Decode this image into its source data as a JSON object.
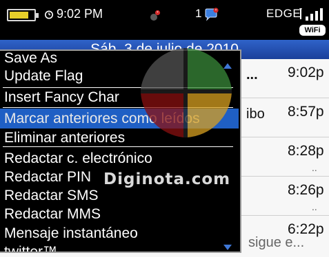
{
  "status_bar": {
    "battery_level": 0.7,
    "battery_color": "#e7cf2a",
    "alarm_icon": "alarm-clock-icon",
    "time": "9:02 PM",
    "bbm_count": "1",
    "network": "EDGE",
    "wifi_label": "WiFi"
  },
  "date_header": "Sáb, 3 de julio de 2010",
  "messages": [
    {
      "subject": "...",
      "time": "9:02p",
      "dots": ""
    },
    {
      "subject": "ibo",
      "time": "8:57p",
      "dots": ""
    },
    {
      "subject": "",
      "time": "8:28p",
      "dots": ".."
    },
    {
      "subject": "",
      "time": "8:26p",
      "dots": ".."
    },
    {
      "subject": "sigue e...",
      "time": "6:22p",
      "dots": ""
    }
  ],
  "menu": {
    "items": [
      "Save As",
      "Update Flag",
      "Insert Fancy Char",
      "Marcar anteriores como leídos",
      "Eliminar anteriores",
      "Redactar c. electrónico",
      "Redactar PIN",
      "Redactar SMS",
      "Redactar MMS",
      "Mensaje instantáneo",
      "twitter™"
    ],
    "selected_index": 3,
    "highlight_color": "#1f5fc4"
  },
  "watermark": "Diginota.com"
}
